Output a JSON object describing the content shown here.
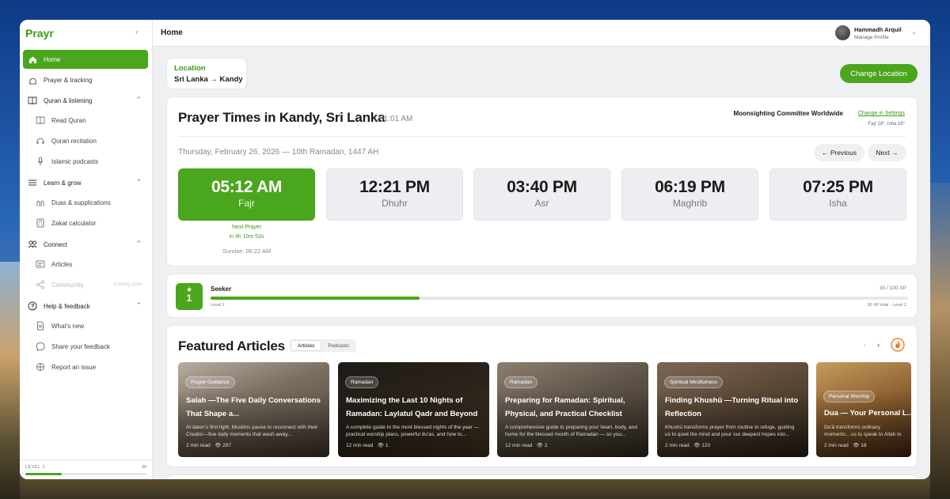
{
  "app": {
    "name": "Prayr"
  },
  "sidebar": {
    "home": "Home",
    "prayer_tracking": "Prayer & tracking",
    "sections": [
      {
        "label": "Quran & listening",
        "items": [
          {
            "label": "Read Quran",
            "icon": "book-icon"
          },
          {
            "label": "Quran recitation",
            "icon": "headphones-icon"
          },
          {
            "label": "Islamic podcasts",
            "icon": "mic-icon"
          }
        ]
      },
      {
        "label": "Learn & grow",
        "items": [
          {
            "label": "Duas & supplications",
            "icon": "hands-icon"
          },
          {
            "label": "Zakat calculator",
            "icon": "calculator-icon"
          }
        ]
      },
      {
        "label": "Connect",
        "items": [
          {
            "label": "Articles",
            "icon": "article-icon"
          },
          {
            "label": "Community",
            "icon": "share-icon",
            "badge": "Coming soon"
          }
        ]
      },
      {
        "label": "Help & feedback",
        "items": [
          {
            "label": "What's new",
            "icon": "doc-icon"
          },
          {
            "label": "Share your feedback",
            "icon": "chat-icon"
          },
          {
            "label": "Report an issue",
            "icon": "bug-icon"
          }
        ]
      }
    ],
    "footer": {
      "level": "LEVEL 1",
      "points": "30",
      "progress": 0.3
    }
  },
  "topbar": {
    "title": "Home",
    "user_name": "Hammadh Arquil",
    "user_sub": "Manage Profile"
  },
  "location": {
    "label": "Location",
    "value": "Sri Lanka → Kandy",
    "change_button": "Change Location"
  },
  "prayer": {
    "title": "Prayer Times in Kandy, Sri Lanka",
    "current_time": "· 01:01 AM",
    "authority": "Moonsighting Committee Worldwide",
    "change_settings": "Change in Settings",
    "angles": "Fajr 18°, Isha 18°",
    "date": "Thursday, February 26, 2026 — 10th Ramadan, 1447 AH",
    "prev": "← Previous",
    "next": "Next →",
    "times": [
      {
        "time": "05:12 AM",
        "name": "Fajr",
        "active": true
      },
      {
        "time": "12:21 PM",
        "name": "Dhuhr"
      },
      {
        "time": "03:40 PM",
        "name": "Asr"
      },
      {
        "time": "06:19 PM",
        "name": "Maghrib"
      },
      {
        "time": "07:25 PM",
        "name": "Isha"
      }
    ],
    "next_prayer_label": "Next Prayer",
    "next_prayer_in": "in 4h 10m 52s",
    "sunrise": "Sunrise: 06:22 AM"
  },
  "xp": {
    "star": "★",
    "level_num": "1",
    "rank": "Seeker",
    "level": "Level 1",
    "points": "30 / 100 XP",
    "total": "30 XP total · Level 2",
    "progress": 0.3
  },
  "articles": {
    "title": "Featured Articles",
    "tabs": [
      "Articles",
      "Podcasts"
    ],
    "items": [
      {
        "tag": "Prayer Guidance",
        "title": "Salah —The Five Daily Conversations That Shape a...",
        "desc": "At dawn's first light, Muslims pause to reconnect with their Creator—five daily moments that wash away...",
        "read": "2 min read",
        "views": "297"
      },
      {
        "tag": "Ramadan",
        "title": "Maximizing the Last 10 Nights of Ramadan: Laylatul Qadr and Beyond",
        "desc": "A complete guide to the most blessed nights of the year — practical worship plans, powerful du'as, and how to...",
        "read": "12 min read",
        "views": "1"
      },
      {
        "tag": "Ramadan",
        "title": "Preparing for Ramadan: Spiritual, Physical, and Practical Checklist",
        "desc": "A comprehensive guide to preparing your heart, body, and home for the blessed month of Ramadan — so you...",
        "read": "12 min read",
        "views": "2"
      },
      {
        "tag": "Spiritual Mindfulness",
        "title": "Finding Khushū —Turning Ritual into Reflection",
        "desc": "Khushū transforms prayer from routine to refuge, guiding us to quiet the mind and pour our deepest hopes into...",
        "read": "2 min read",
        "views": "120"
      },
      {
        "tag": "Personal Worship",
        "title": "Dua — Your Personal L...",
        "desc": "Du'ā transforms ordinary moments... us to speak to Allah in our own words...",
        "read": "2 min read",
        "views": "18"
      }
    ]
  },
  "colors": {
    "accent": "#4aa61c",
    "accent_text": "#3d9a14"
  }
}
